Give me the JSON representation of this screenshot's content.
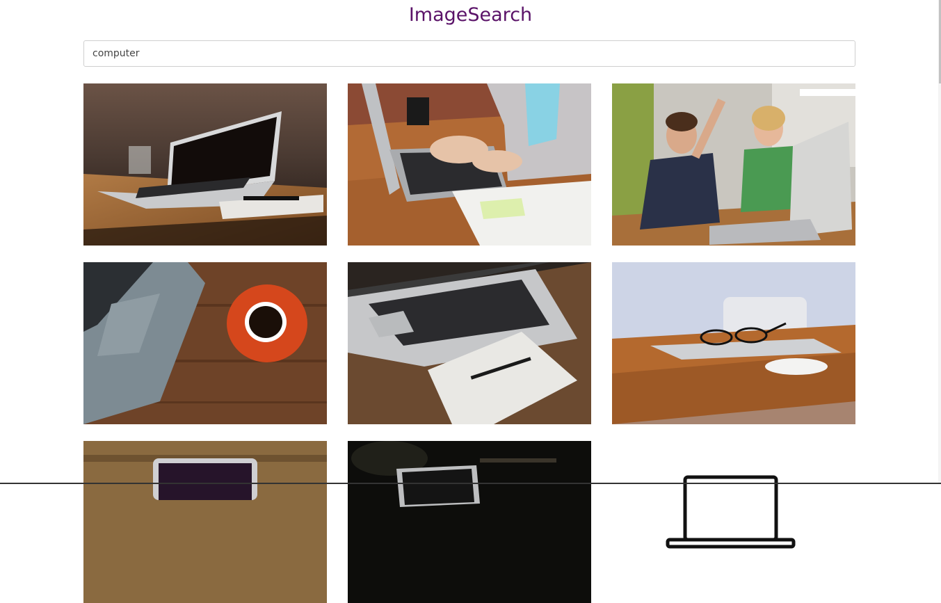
{
  "header": {
    "title": "ImageSearch"
  },
  "search": {
    "value": "computer"
  },
  "results": [
    {
      "name": "laptop-on-table-with-glass"
    },
    {
      "name": "person-typing-on-laptop"
    },
    {
      "name": "kids-cheering-at-laptop"
    },
    {
      "name": "laptop-and-coffee-cup"
    },
    {
      "name": "laptop-and-notebook-with-pen"
    },
    {
      "name": "closed-laptop-with-glasses-and-mouse"
    },
    {
      "name": "laptop-on-wooden-desk"
    },
    {
      "name": "laptop-in-dark-room"
    },
    {
      "name": "laptop-line-icon"
    }
  ],
  "colors": {
    "title": "#5a1268"
  }
}
